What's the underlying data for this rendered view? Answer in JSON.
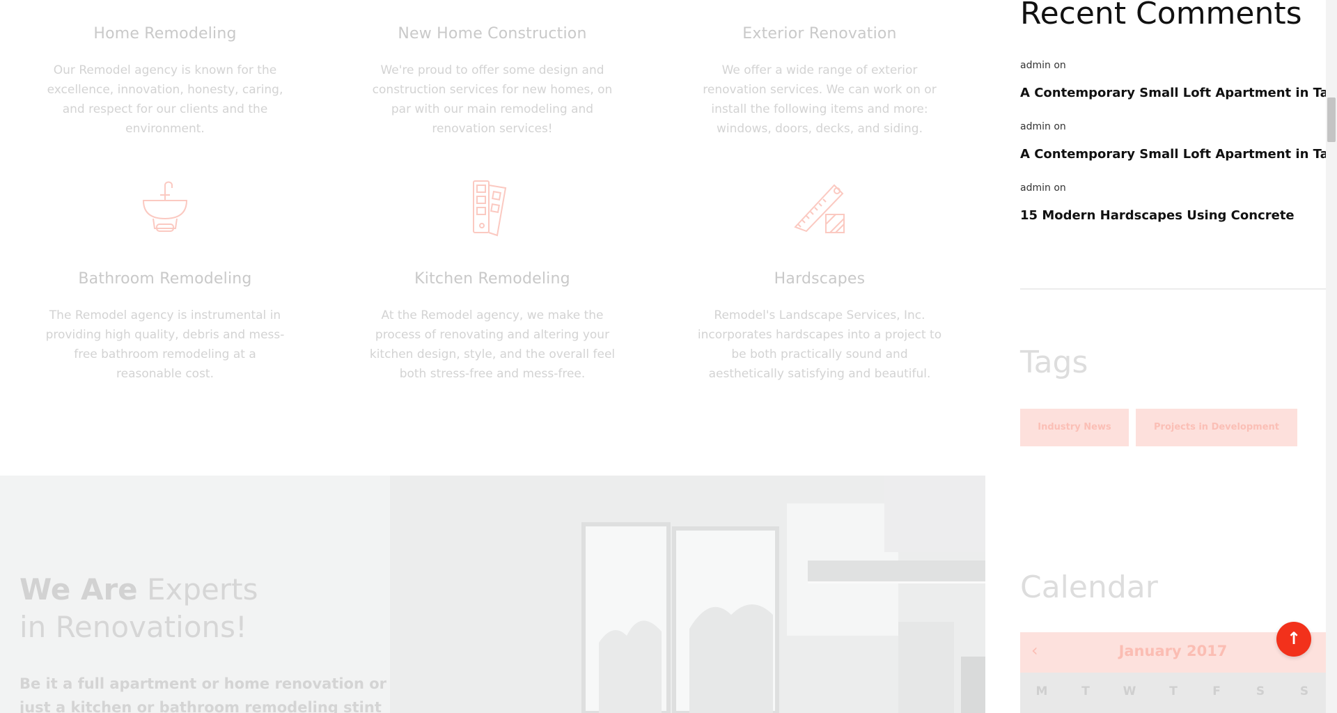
{
  "services": [
    {
      "title": "Home Remodeling",
      "text": "Our Remodel agency is known for the excellence, innovation, honesty, caring, and respect for our clients and the environment."
    },
    {
      "title": "New Home Construction",
      "text": "We're proud to offer some design and construction services for new homes, on par with our main remodeling and renovation services!"
    },
    {
      "title": "Exterior Renovation",
      "text": "We offer a wide range of exterior renovation services. We can work on or install the following items and more: windows, doors, decks, and siding."
    },
    {
      "title": "Bathroom Remodeling",
      "text": "The Remodel agency is instrumental in providing high quality, debris and mess-free bathroom remodeling at a reasonable cost.",
      "icon": "sink-icon"
    },
    {
      "title": "Kitchen Remodeling",
      "text": "At the Remodel agency, we make the process of renovating and altering your kitchen design, style, and the overall feel both stress-free and mess-free.",
      "icon": "color-swatch-icon"
    },
    {
      "title": "Hardscapes",
      "text": "Remodel's Landscape Services, Inc. incorporates hardscapes into a project to be both practically sound and aesthetically satisfying and beautiful.",
      "icon": "saw-tile-icon"
    }
  ],
  "hero": {
    "title_bold": "We Are",
    "title_rest": " Experts",
    "title_line2": "in Renovations!",
    "subtitle": "Be it a full apartment or home renovation or just a kitchen or bathroom remodeling stint"
  },
  "recent_comments": {
    "title": "Recent Comments",
    "items": [
      {
        "author": "admin on",
        "post": "A Contemporary Small Loft Apartment in Taiwan"
      },
      {
        "author": "admin on",
        "post": "A Contemporary Small Loft Apartment in Taiwan"
      },
      {
        "author": "admin on",
        "post": "15 Modern Hardscapes Using Concrete"
      }
    ]
  },
  "tags": {
    "title": "Tags",
    "items": [
      "Industry News",
      "Projects in Development"
    ]
  },
  "calendar": {
    "title": "Calendar",
    "month": "January 2017",
    "prev_icon": "chevron-left-icon",
    "weekdays": [
      "M",
      "T",
      "W",
      "T",
      "F",
      "S",
      "S"
    ]
  },
  "back_to_top": {
    "icon": "arrow-up-icon",
    "symbol": "↑"
  },
  "colors": {
    "accent": "#f2311b",
    "accent_faded": "#fde0dc"
  }
}
